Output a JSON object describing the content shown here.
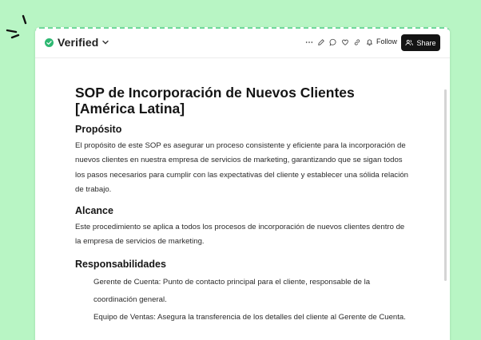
{
  "header": {
    "status_label": "Verified",
    "follow_label": "Follow",
    "share_label": "Share"
  },
  "doc": {
    "title_line1": "SOP de Incorporación de Nuevos Clientes",
    "title_line2": "[América Latina]",
    "sections": {
      "purpose_heading": "Propósito",
      "purpose_text": "El propósito de este SOP es asegurar un proceso consistente y eficiente para la incorporación de nuevos clientes en nuestra empresa de servicios de marketing, garantizando que se sigan todos los pasos necesarios para cumplir con las expectativas del cliente y establecer una sólida relación de trabajo.",
      "scope_heading": "Alcance",
      "scope_text": "Este procedimiento se aplica a todos los procesos de incorporación de nuevos clientes dentro de la empresa de servicios de marketing.",
      "resp_heading": "Responsabilidades",
      "resp_items": [
        "Gerente de Cuenta: Punto de contacto principal para el cliente, responsable de la coordinación general.",
        "Equipo de Ventas: Asegura la transferencia de los detalles del cliente al Gerente de Cuenta."
      ]
    }
  },
  "icons": {
    "status": "check-circle-icon",
    "more": "more-dots-icon",
    "edit": "pencil-icon",
    "comment": "comment-icon",
    "like": "heart-icon",
    "link": "link-icon",
    "bell": "bell-icon",
    "share": "users-icon"
  },
  "colors": {
    "background": "#b8f5c4",
    "verified_check": "#2eb872",
    "share_button": "#141414"
  }
}
